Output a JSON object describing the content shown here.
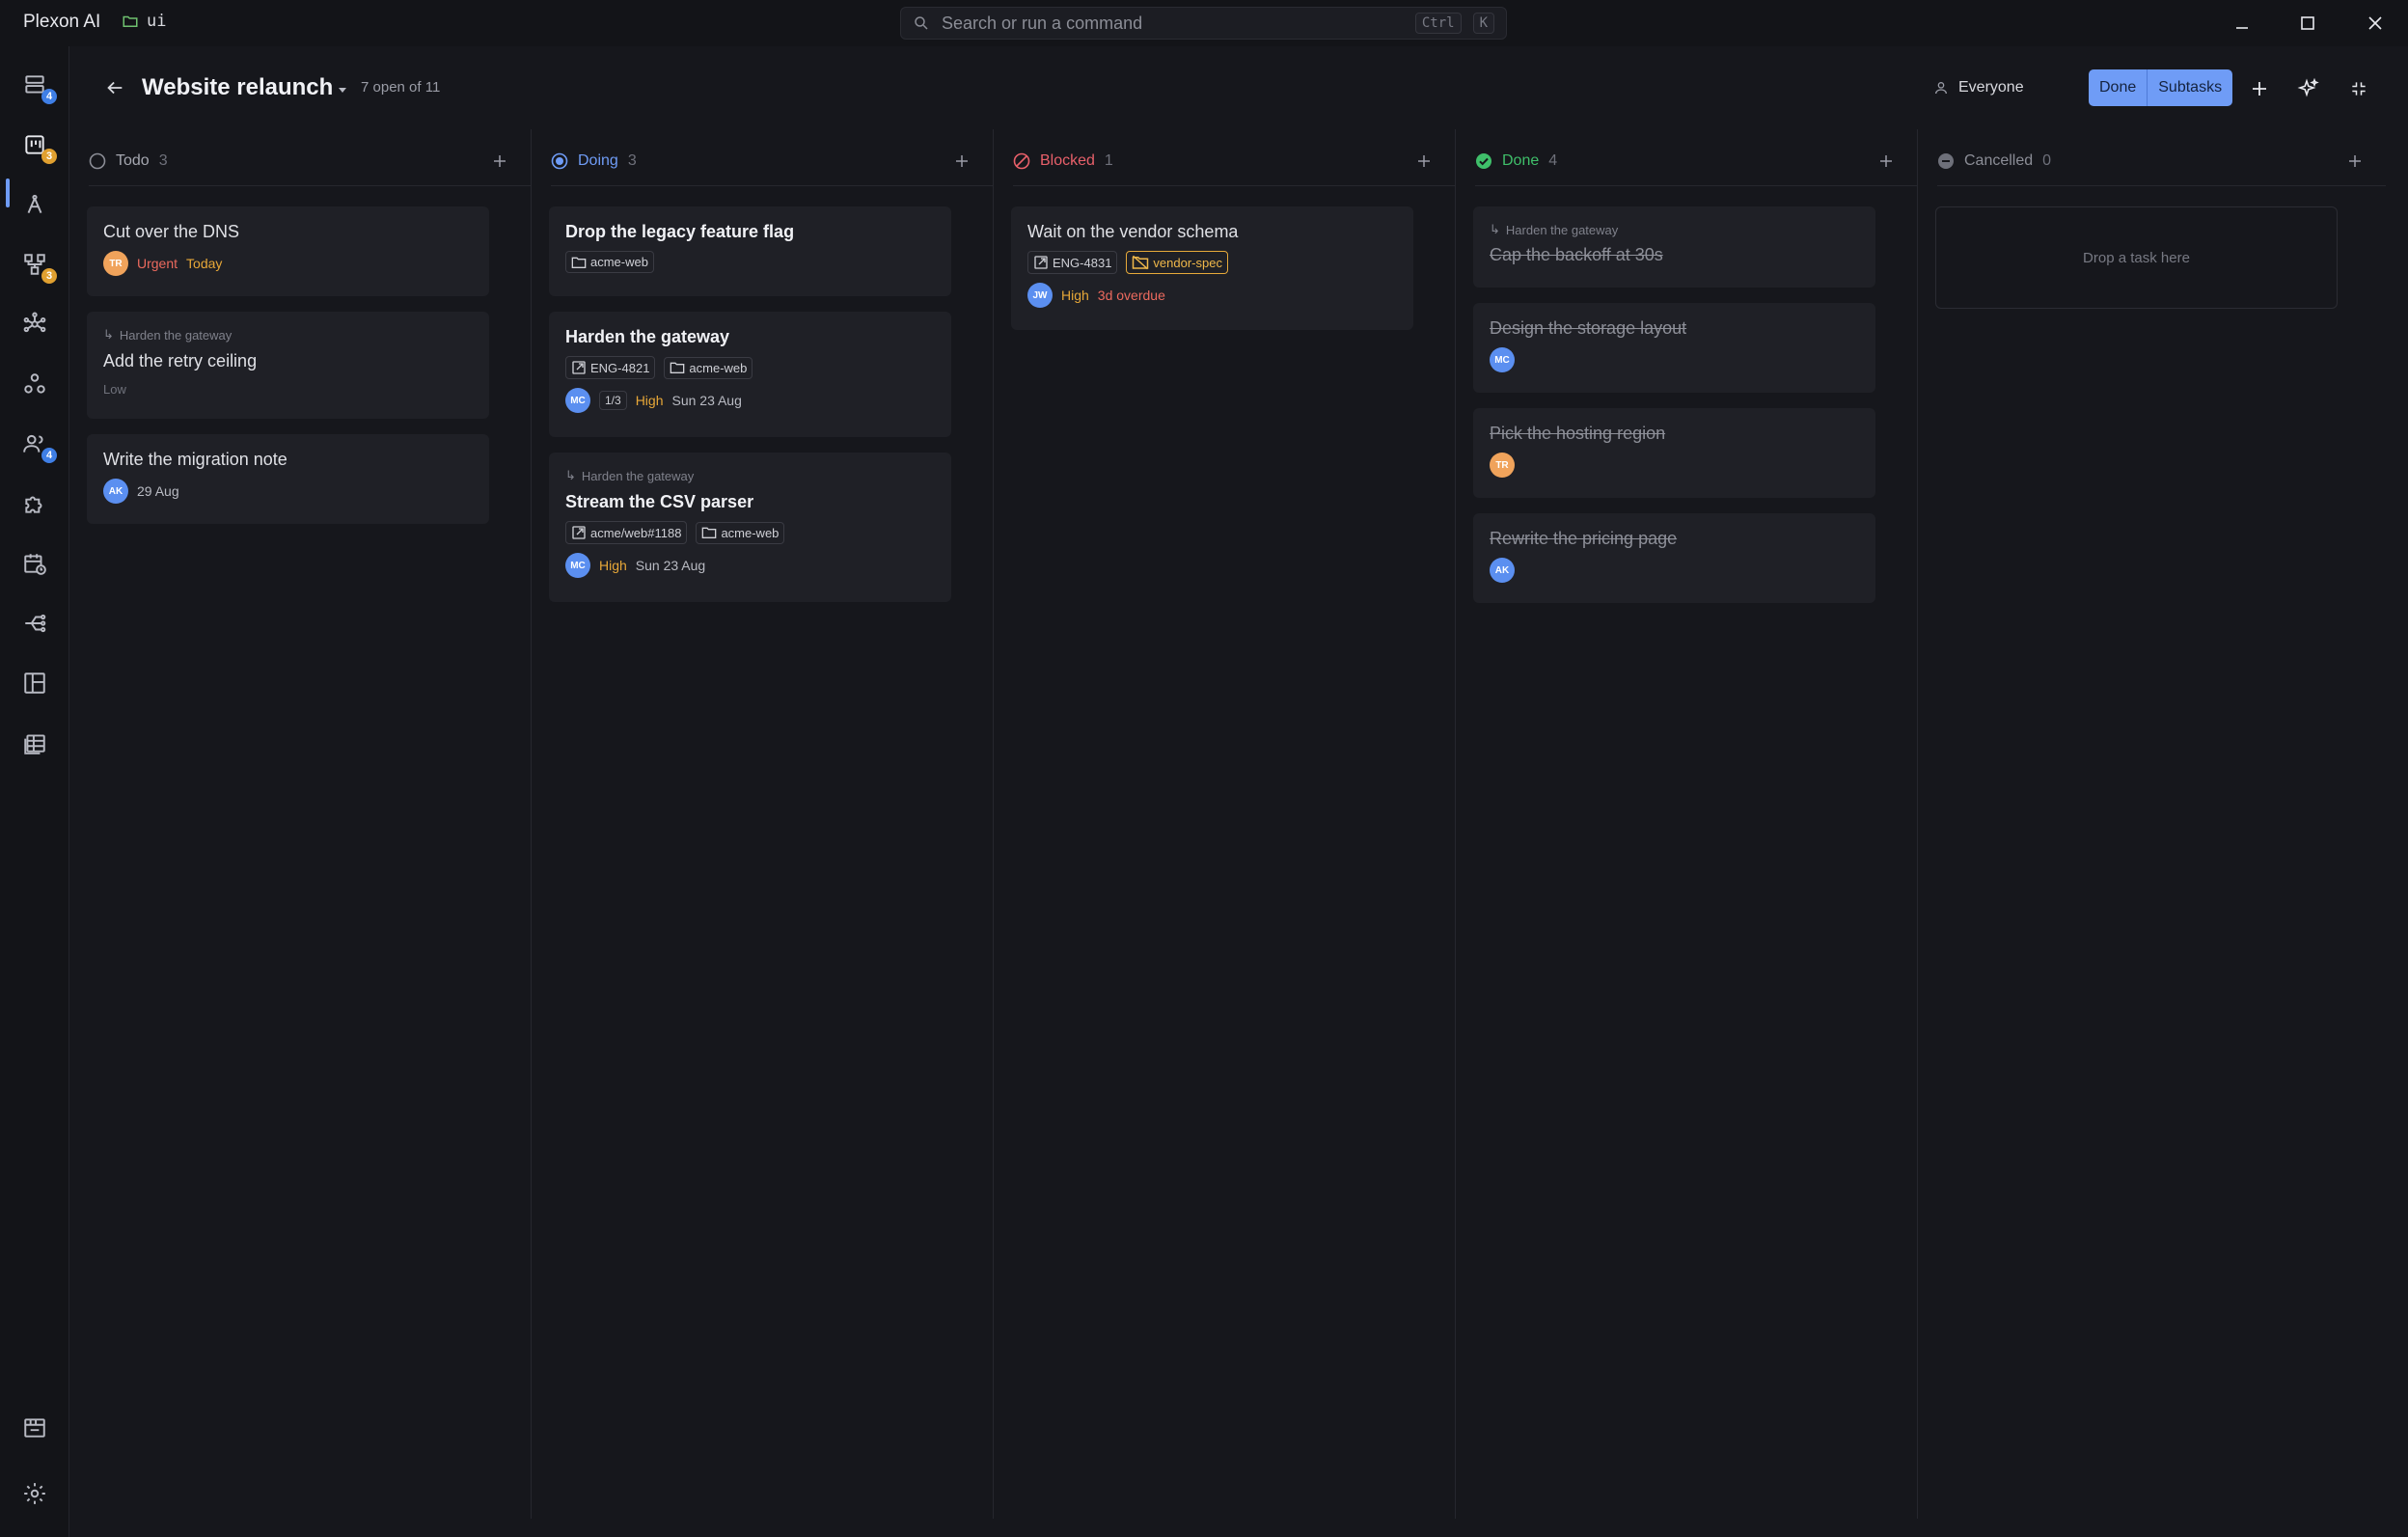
{
  "app": {
    "name": "Plexon AI",
    "workspace": "ui"
  },
  "search": {
    "placeholder": "Search or run a command",
    "key1": "Ctrl",
    "key2": "K"
  },
  "rail": {
    "badges": {
      "inbox": "4",
      "board": "3",
      "flow": "3",
      "team": "4"
    }
  },
  "project": {
    "title": "Website relaunch",
    "count": "7 open of 11"
  },
  "filters": {
    "assignee": "Everyone",
    "done_label": "Done",
    "subtasks_label": "Subtasks"
  },
  "columns": [
    {
      "name": "Todo",
      "count": "3",
      "cards": [
        {
          "title": "Cut over the DNS",
          "avatar": "TR",
          "priority": "Urgent",
          "due": "Today"
        },
        {
          "parent": "Harden the gateway",
          "title": "Add the retry ceiling",
          "priority": "Low"
        },
        {
          "title": "Write the migration note",
          "avatar": "AK",
          "due": "29 Aug"
        }
      ]
    },
    {
      "name": "Doing",
      "count": "3",
      "cards": [
        {
          "title": "Drop the legacy feature flag",
          "repo": "acme-web"
        },
        {
          "title": "Harden the gateway",
          "issue": "ENG-4821",
          "repo": "acme-web",
          "avatar": "MC",
          "subtasks": "1/3",
          "priority": "High",
          "due": "Sun 23 Aug"
        },
        {
          "parent": "Harden the gateway",
          "title": "Stream the CSV parser",
          "issue": "acme/web#1188",
          "repo": "acme-web",
          "avatar": "MC",
          "priority": "High",
          "due": "Sun 23 Aug"
        }
      ]
    },
    {
      "name": "Blocked",
      "count": "1",
      "cards": [
        {
          "title": "Wait on the vendor schema",
          "issue": "ENG-4831",
          "tag": "vendor-spec",
          "avatar": "JW",
          "priority": "High",
          "due": "3d overdue"
        }
      ]
    },
    {
      "name": "Done",
      "count": "4",
      "cards": [
        {
          "parent": "Harden the gateway",
          "title": "Cap the backoff at 30s"
        },
        {
          "title": "Design the storage layout",
          "avatar": "MC"
        },
        {
          "title": "Pick the hosting region",
          "avatar": "TR"
        },
        {
          "title": "Rewrite the pricing page",
          "avatar": "AK"
        }
      ]
    },
    {
      "name": "Cancelled",
      "count": "0",
      "empty": "Drop a task here"
    }
  ],
  "colors": {
    "accent": "#6f9cf6",
    "urgent": "#ec6a5e",
    "high": "#e8a838",
    "done": "#3fbf6a",
    "blocked": "#e8606a"
  }
}
